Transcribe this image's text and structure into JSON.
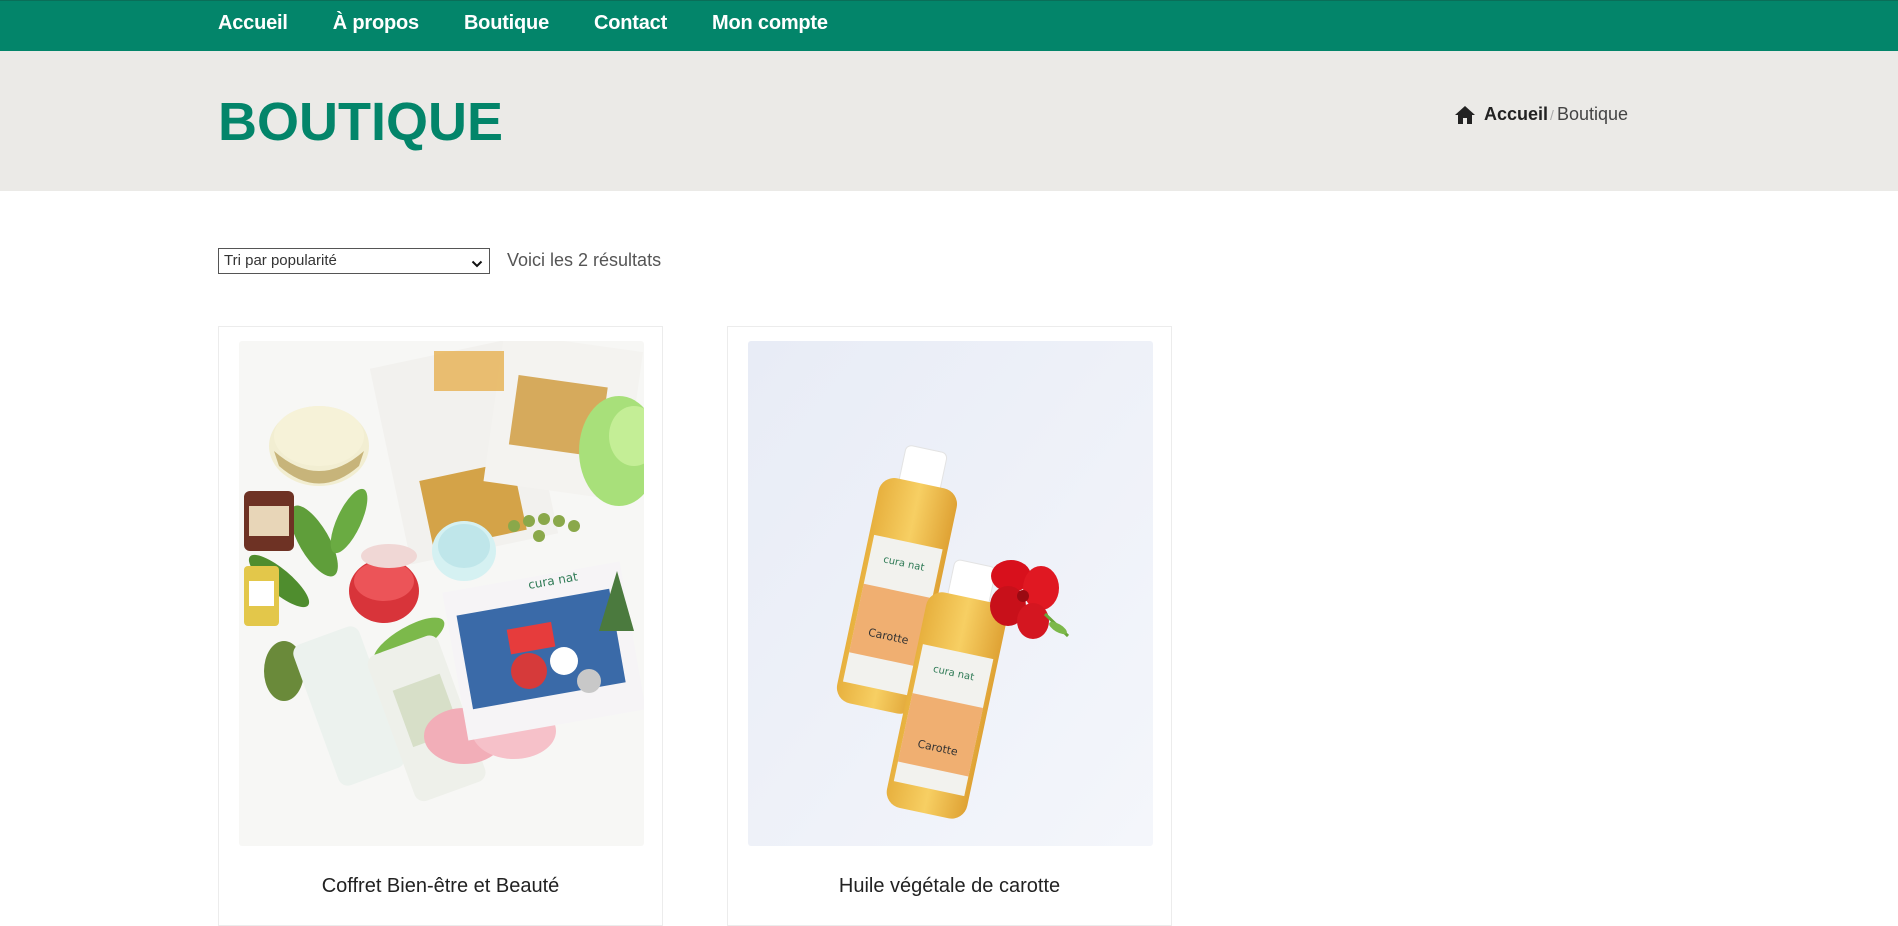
{
  "nav": {
    "items": [
      {
        "label": "Accueil"
      },
      {
        "label": "À propos"
      },
      {
        "label": "Boutique"
      },
      {
        "label": "Contact"
      },
      {
        "label": "Mon compte"
      }
    ]
  },
  "banner": {
    "title": "BOUTIQUE",
    "breadcrumb": {
      "home_icon": "home-icon",
      "home_label": "Accueil",
      "separator": "/",
      "current": "Boutique"
    }
  },
  "shop": {
    "sort": {
      "selected": "Tri par popularité",
      "icon": "chevron-down-icon"
    },
    "result_count": "Voici les 2 résultats",
    "products": [
      {
        "name": "Coffret Bien-être et Beauté",
        "image": "gift-box-cosmetics-photo"
      },
      {
        "name": "Huile végétale de carotte",
        "image": "carrot-oil-bottles-photo",
        "bottle_label": "Carotte",
        "brand": "cura nat"
      }
    ]
  },
  "colors": {
    "brand_green": "#03856a",
    "banner_bg": "#ebeae7"
  }
}
